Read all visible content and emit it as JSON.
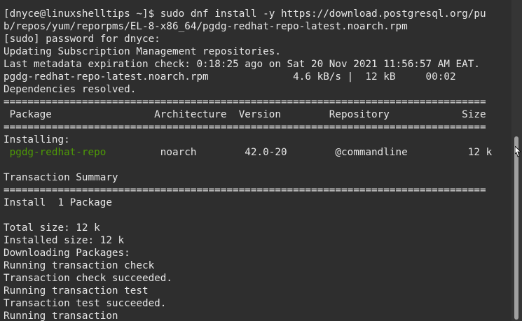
{
  "terminal": {
    "command_line_1": "[dnyce@linuxshelltips ~]$ sudo dnf install -y https://download.postgresql.org/pu",
    "command_line_2": "b/repos/yum/reporpms/EL-8-x86_64/pgdg-redhat-repo-latest.noarch.rpm",
    "sudo_prompt": "[sudo] password for dnyce:",
    "updating_repos": "Updating Subscription Management repositories.",
    "metadata_check": "Last metadata expiration check: 0:18:25 ago on Sat 20 Nov 2021 11:56:57 AM EAT.",
    "download_line": "pgdg-redhat-repo-latest.noarch.rpm              4.6 kB/s |  12 kB     00:02",
    "dependencies_resolved": "Dependencies resolved.",
    "separator": "================================================================================",
    "table_header": " Package                 Architecture  Version        Repository            Size",
    "installing_label": "Installing:",
    "package_row": {
      "name": " pgdg-redhat-repo",
      "rest": "         noarch        42.0-20        @commandline          12 k"
    },
    "blank": "",
    "transaction_summary": "Transaction Summary",
    "install_count": "Install  1 Package",
    "total_size": "Total size: 12 k",
    "installed_size": "Installed size: 12 k",
    "downloading_packages": "Downloading Packages:",
    "running_check": "Running transaction check",
    "check_succeeded": "Transaction check succeeded.",
    "running_test": "Running transaction test",
    "test_succeeded": "Transaction test succeeded.",
    "running_transaction": "Running transaction"
  },
  "colors": {
    "background": "#2e2e2e",
    "text": "#e6e6e6",
    "package_name": "#4e9a06"
  }
}
